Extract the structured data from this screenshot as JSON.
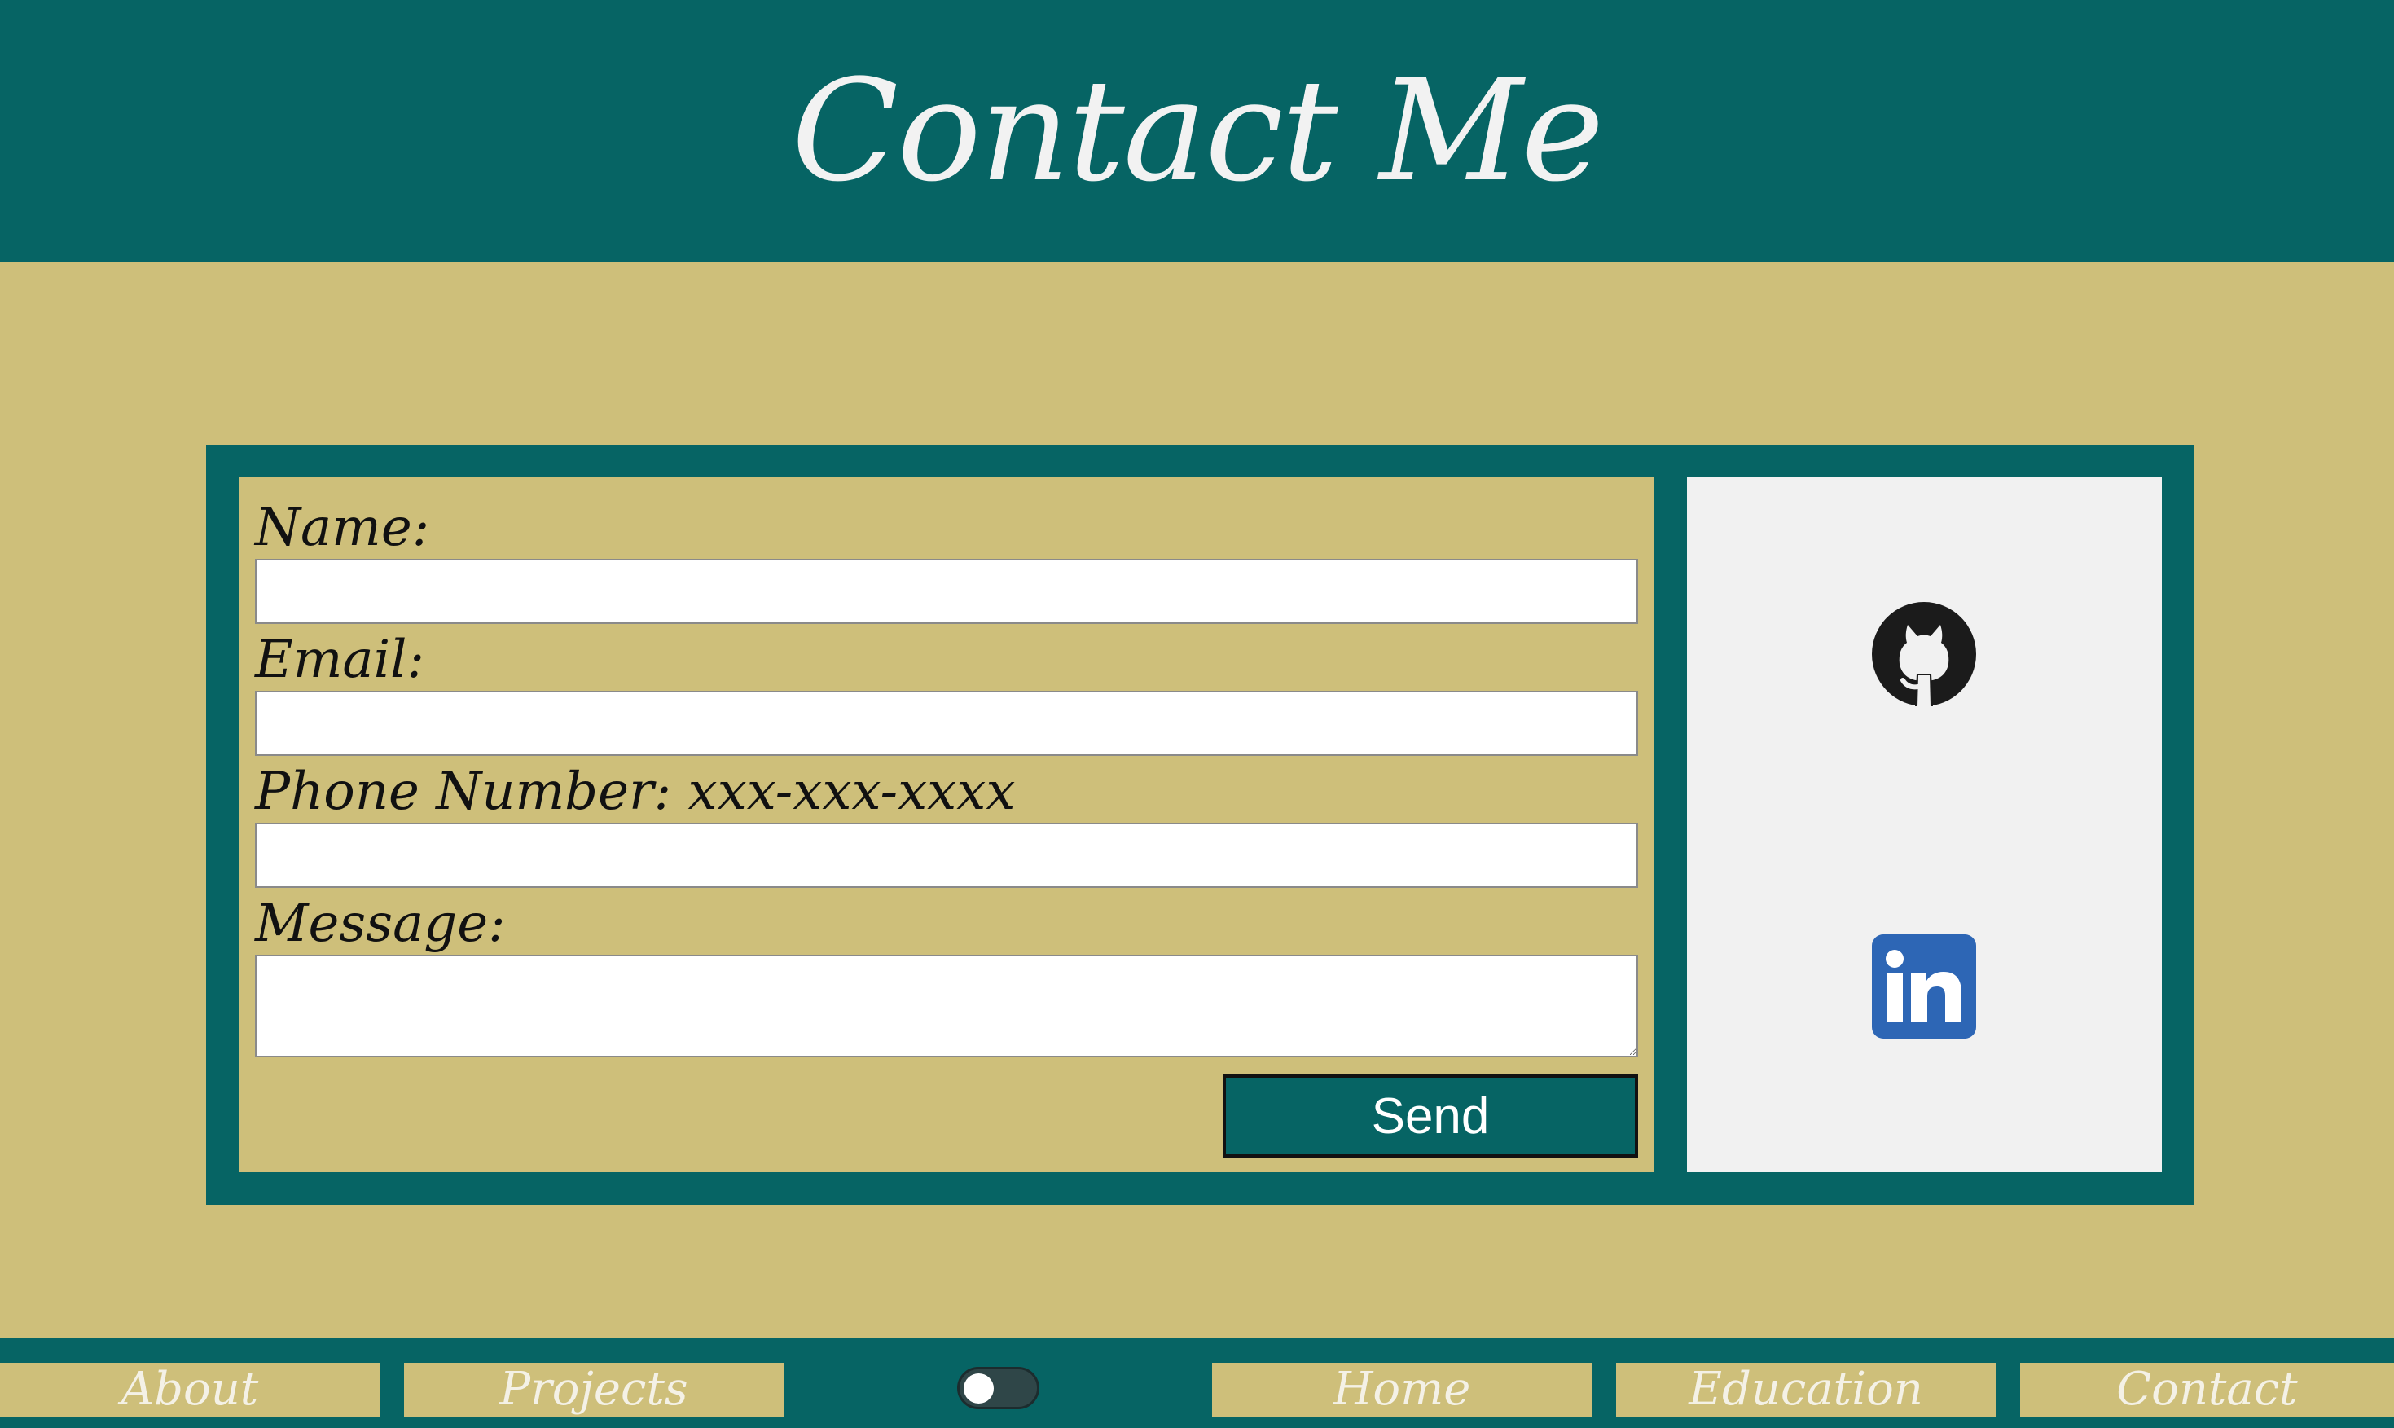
{
  "header": {
    "title": "Contact Me"
  },
  "form": {
    "name_label": "Name:",
    "name_value": "",
    "email_label": "Email:",
    "email_value": "",
    "phone_label": "Phone Number: xxx-xxx-xxxx",
    "phone_value": "",
    "message_label": "Message:",
    "message_value": "",
    "send_label": "Send"
  },
  "social": {
    "links": [
      {
        "icon": "github-icon",
        "target": "GitHub"
      },
      {
        "icon": "linkedin-icon",
        "target": "LinkedIn"
      }
    ]
  },
  "nav": {
    "items": [
      "About",
      "Projects",
      "Home",
      "Education",
      "Contact"
    ],
    "theme_toggle": {
      "state": "off"
    }
  },
  "colors": {
    "primary": "#066464",
    "background": "#cebf7a",
    "panel": "#f1f1f1",
    "linkedin": "#2d66b5",
    "github": "#1b1b1b"
  }
}
